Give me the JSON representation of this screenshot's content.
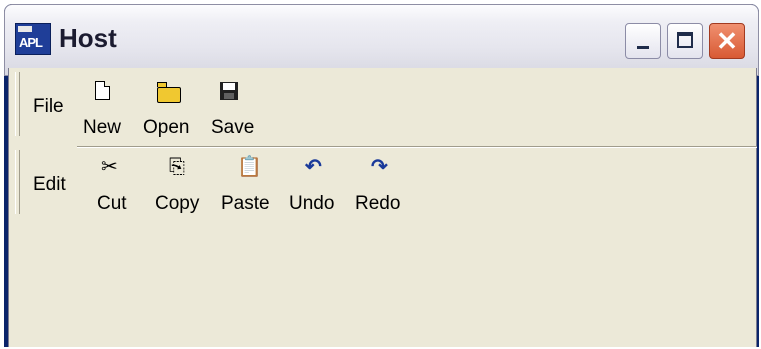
{
  "window": {
    "title": "Host",
    "app_icon_text": "APL",
    "controls": {
      "minimize": "minimize-icon",
      "maximize": "maximize-icon",
      "close": "close-icon",
      "close_glyph": "✕"
    }
  },
  "bands": [
    {
      "label": "File",
      "tools": [
        {
          "label": "New",
          "icon": "new-document-icon"
        },
        {
          "label": "Open",
          "icon": "open-folder-icon"
        },
        {
          "label": "Save",
          "icon": "save-disk-icon"
        }
      ]
    },
    {
      "label": "Edit",
      "tools": [
        {
          "label": "Cut",
          "icon": "scissors-icon",
          "glyph": "✂"
        },
        {
          "label": "Copy",
          "icon": "copy-icon",
          "glyph": "⎘"
        },
        {
          "label": "Paste",
          "icon": "paste-clipboard-icon",
          "glyph": "📋"
        },
        {
          "label": "Undo",
          "icon": "undo-arrow-icon",
          "glyph": "↶"
        },
        {
          "label": "Redo",
          "icon": "redo-arrow-icon",
          "glyph": "↷"
        }
      ]
    }
  ],
  "colors": {
    "titlebar_top": "#fcfcfe",
    "titlebar_bottom": "#d8d8e2",
    "client_bg": "#ece9d8",
    "close_button": "#d85a34",
    "icon_blue": "#1a3a9a"
  }
}
